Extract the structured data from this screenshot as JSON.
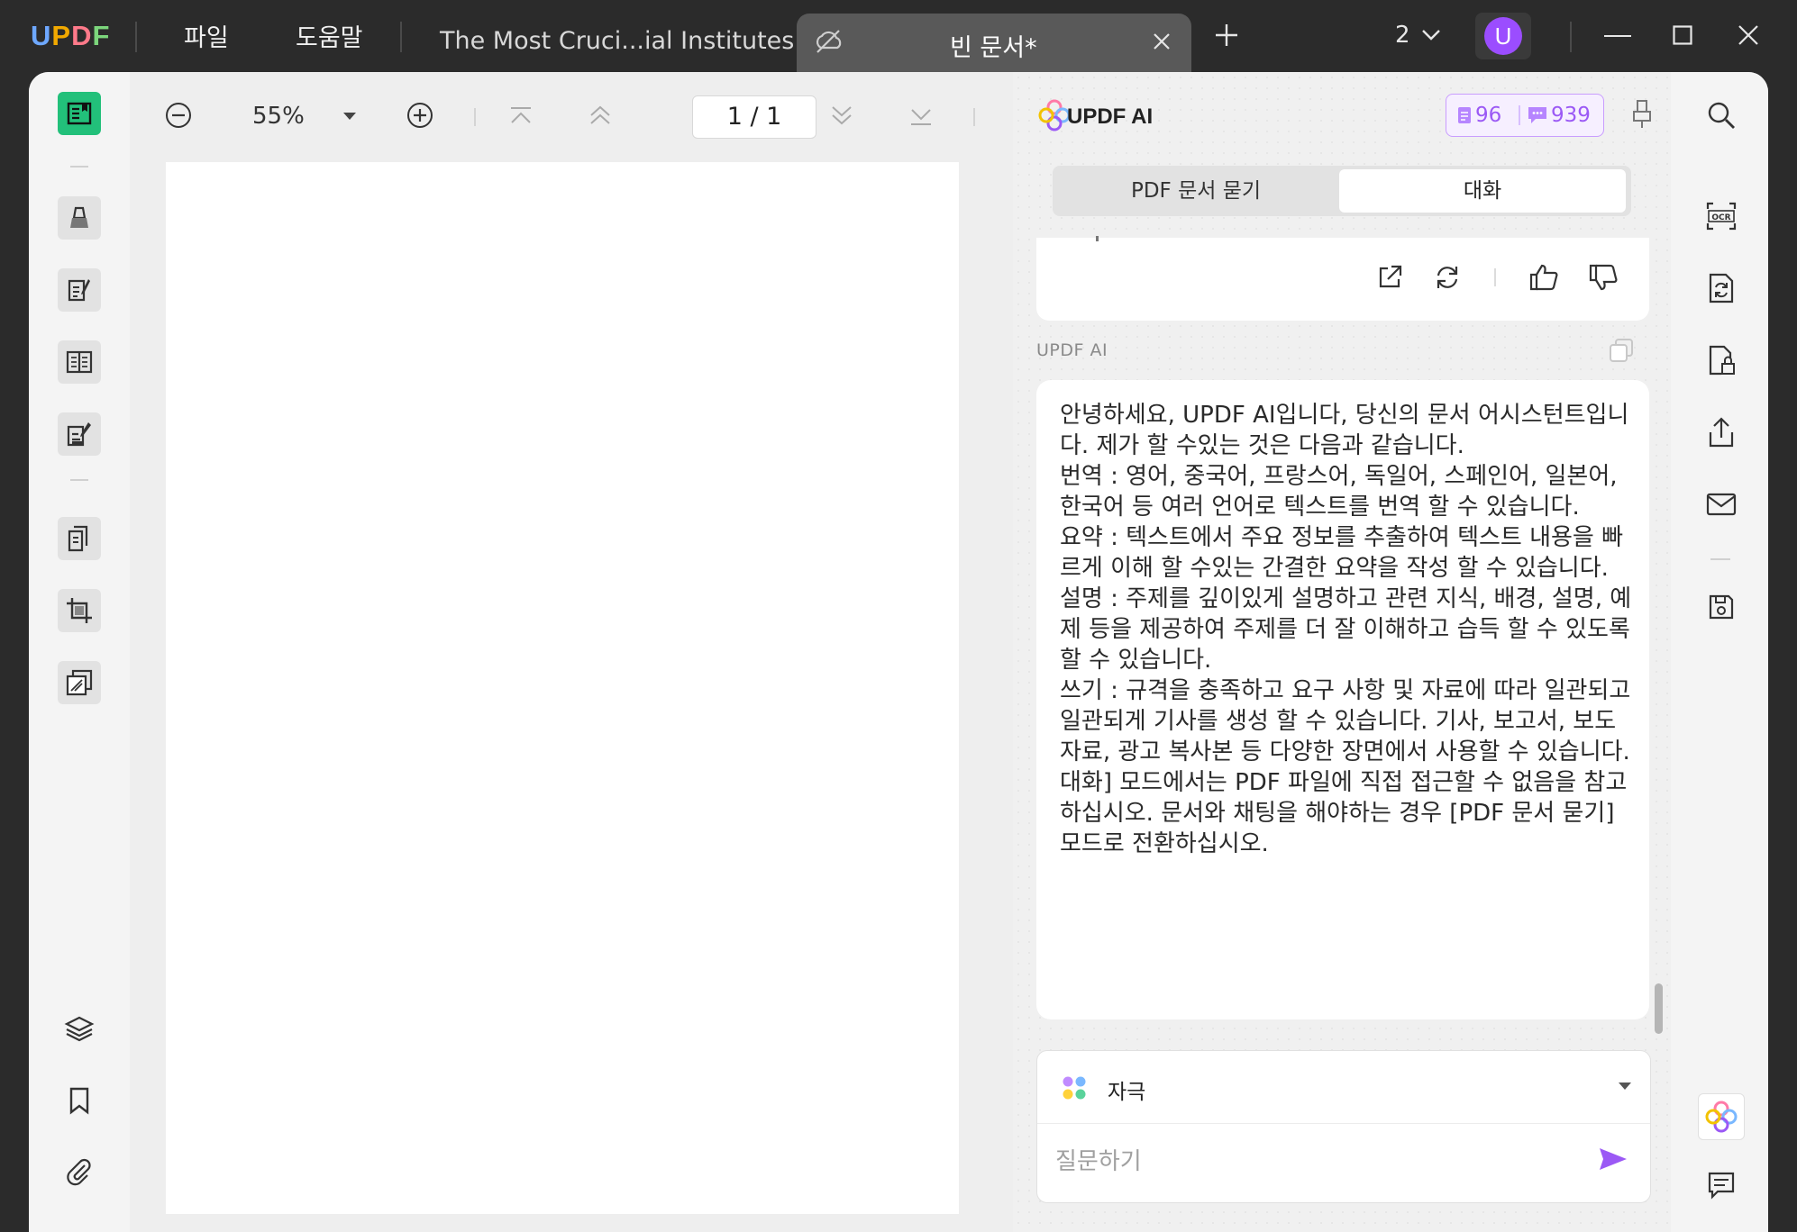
{
  "app": {
    "brand": "UPDF",
    "menus": [
      "파일",
      "도움말"
    ],
    "tabs": [
      {
        "label": "The Most Cruci...ial Institutes",
        "active": false
      },
      {
        "label": "빈 문서*",
        "active": true
      }
    ],
    "window_count": "2",
    "user_initial": "U"
  },
  "viewer": {
    "zoom": "55%",
    "page_indicator": "1  /  1"
  },
  "ai_panel": {
    "title": "UPDF AI",
    "credits": {
      "docs": "96",
      "chats": "939"
    },
    "mode_tabs": [
      "PDF 문서 묻기",
      "대화"
    ],
    "active_mode": "대화",
    "message_author": "UPDF AI",
    "message_paragraphs": [
      "안녕하세요, UPDF AI입니다, 당신의 문서 어시스턴트입니다. 제가 할 수있는 것은 다음과 같습니다.",
      "번역 : 영어, 중국어, 프랑스어, 독일어, 스페인어, 일본어, 한국어 등 여러 언어로 텍스트를 번역 할 수 있습니다.",
      "요약 : 텍스트에서 주요 정보를 추출하여 텍스트 내용을 빠르게 이해 할 수있는 간결한 요약을 작성 할 수 있습니다.",
      "설명 : 주제를 깊이있게 설명하고 관련 지식, 배경, 설명, 예제 등을 제공하여 주제를 더 잘 이해하고 습득 할 수 있도록 할 수 있습니다.",
      "쓰기 : 규격을 충족하고 요구 사항 및 자료에 따라 일관되고 일관되게 기사를 생성 할 수 있습니다. 기사, 보고서, 보도 자료, 광고 복사본 등 다양한 장면에서 사용할 수 있습니다.",
      "대화] 모드에서는 PDF 파일에 직접 접근할 수 없음을 참고하십시오. 문서와 채팅을 해야하는 경우 [PDF 문서 묻기] 모드로 전환하십시오."
    ],
    "prompt_selector": "자극",
    "input_placeholder": "질문하기"
  },
  "colors": {
    "accent_purple": "#9b59f5",
    "active_tool_green": "#22c07a",
    "avatar": "#9b4dff"
  },
  "icons": {
    "left_tools": [
      "reader-icon",
      "comment-icon",
      "edit-pdf-icon",
      "page-layout-icon",
      "form-icon",
      "organize-pages-icon",
      "crop-icon",
      "watermark-icon",
      "layers-icon",
      "bookmark-icon",
      "attachment-icon"
    ],
    "right_tools": [
      "search-icon",
      "ocr-icon",
      "convert-icon",
      "protect-icon",
      "share-icon",
      "email-icon",
      "save-icon",
      "updf-ai-icon",
      "comments-list-icon"
    ]
  }
}
